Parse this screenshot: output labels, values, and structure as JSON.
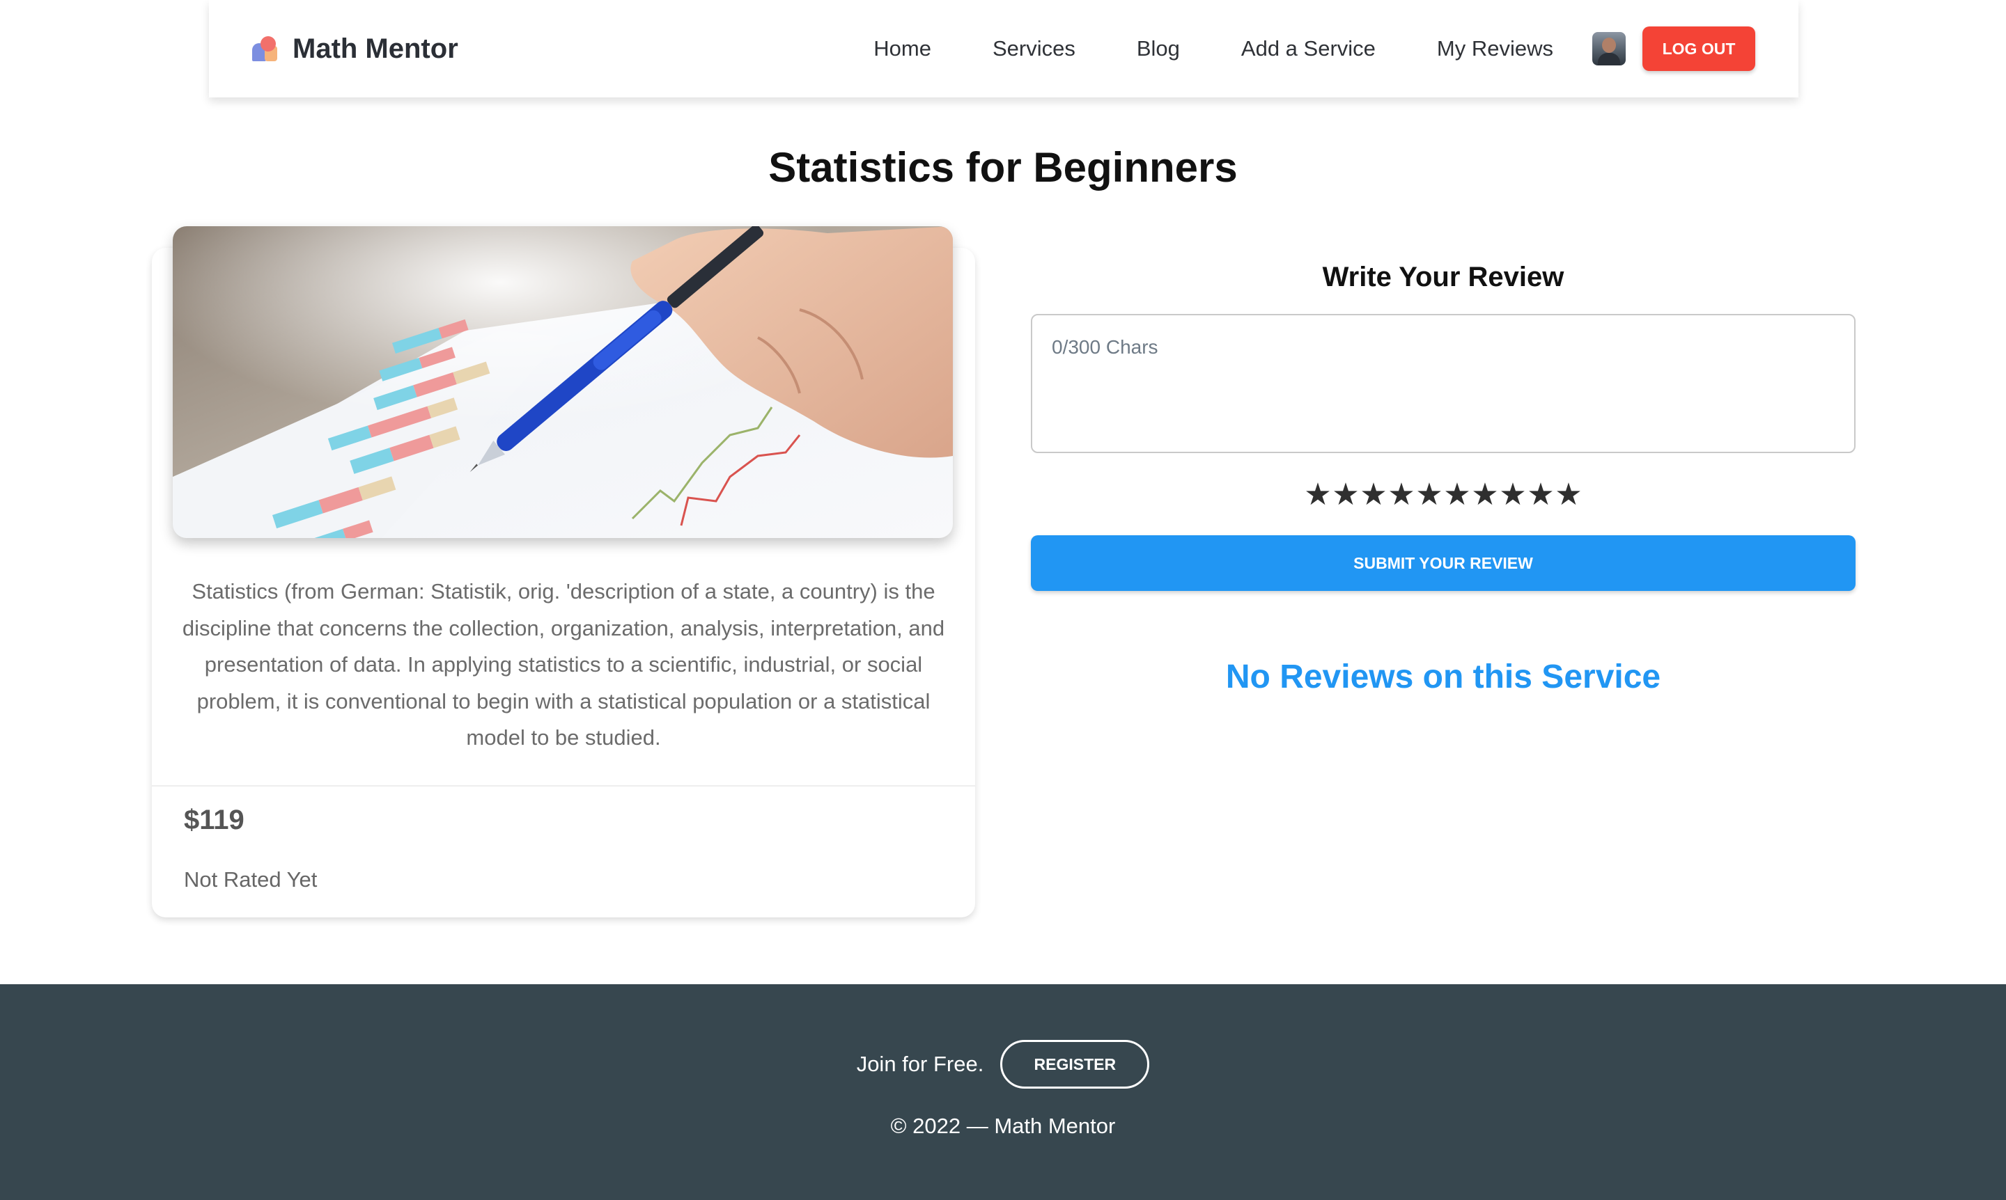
{
  "nav": {
    "brand": "Math Mentor",
    "links": [
      "Home",
      "Services",
      "Blog",
      "Add a Service",
      "My Reviews"
    ],
    "logout_label": "LOG OUT"
  },
  "service": {
    "title": "Statistics for Beginners",
    "description": "Statistics (from German: Statistik, orig. 'description of a state, a country) is the discipline that concerns the collection, organization, analysis, interpretation, and presentation of data. In applying statistics to a scientific, industrial, or social problem, it is conventional to begin with a statistical population or a statistical model to be studied.",
    "price": "$119",
    "rating_text": "Not Rated Yet",
    "image_icon": "chart-and-pen-photo"
  },
  "review": {
    "heading": "Write Your Review",
    "placeholder": "0/300 Chars",
    "stars": [
      "★",
      "★",
      "★",
      "★",
      "★",
      "★",
      "★",
      "★",
      "★",
      "★"
    ],
    "submit_label": "SUBMIT YOUR REVIEW",
    "empty_message": "No Reviews on this Service"
  },
  "footer": {
    "join_text": "Join for Free.",
    "register_label": "REGISTER",
    "copyright": "© 2022 — Math Mentor"
  },
  "colors": {
    "accent_blue": "#2196f3",
    "logout_red": "#f44336",
    "footer_bg": "#37474f"
  }
}
